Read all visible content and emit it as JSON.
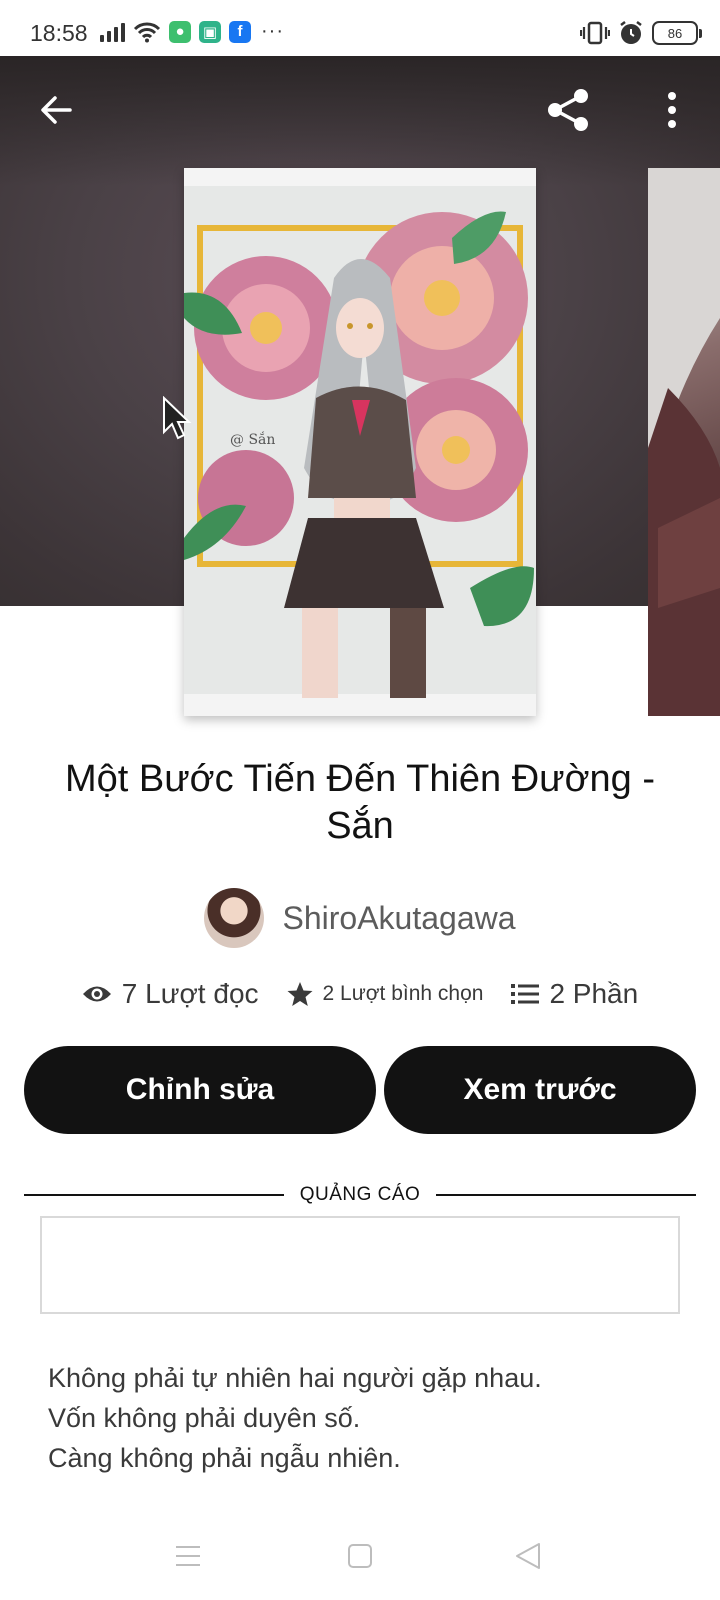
{
  "status_bar": {
    "time": "18:58",
    "battery": "86",
    "overflow": "···",
    "icons": [
      "signal-icon",
      "wifi-icon",
      "app-notification-icon",
      "app-notification-icon",
      "facebook-icon",
      "vibrate-icon",
      "alarm-icon",
      "battery-icon"
    ]
  },
  "header": {
    "back_icon": "back-arrow-icon",
    "share_icon": "share-icon",
    "more_icon": "more-vertical-icon"
  },
  "story": {
    "title": "Một Bước Tiến Đến Thiên Đường - Sắn",
    "author": "ShiroAkutagawa",
    "reads": "7 Lượt đọc",
    "votes": "2 Lượt bình chọn",
    "parts": "2 Phần",
    "cover_signature": "@ Sắn"
  },
  "actions": {
    "edit_label": "Chỉnh sửa",
    "preview_label": "Xem trước"
  },
  "ad": {
    "label": "QUẢNG CÁO"
  },
  "description": {
    "lines": [
      "Không phải tự nhiên hai người gặp nhau.",
      "Vốn không phải duyên số.",
      "Càng không phải ngẫu nhiên."
    ]
  },
  "nav": {
    "icons": [
      "menu-icon",
      "home-square-icon",
      "back-triangle-icon"
    ]
  },
  "colors": {
    "primary_button": "#121212",
    "hero_background": "#4a4146",
    "text": "#121212",
    "muted_text": "#5c5c5c"
  }
}
